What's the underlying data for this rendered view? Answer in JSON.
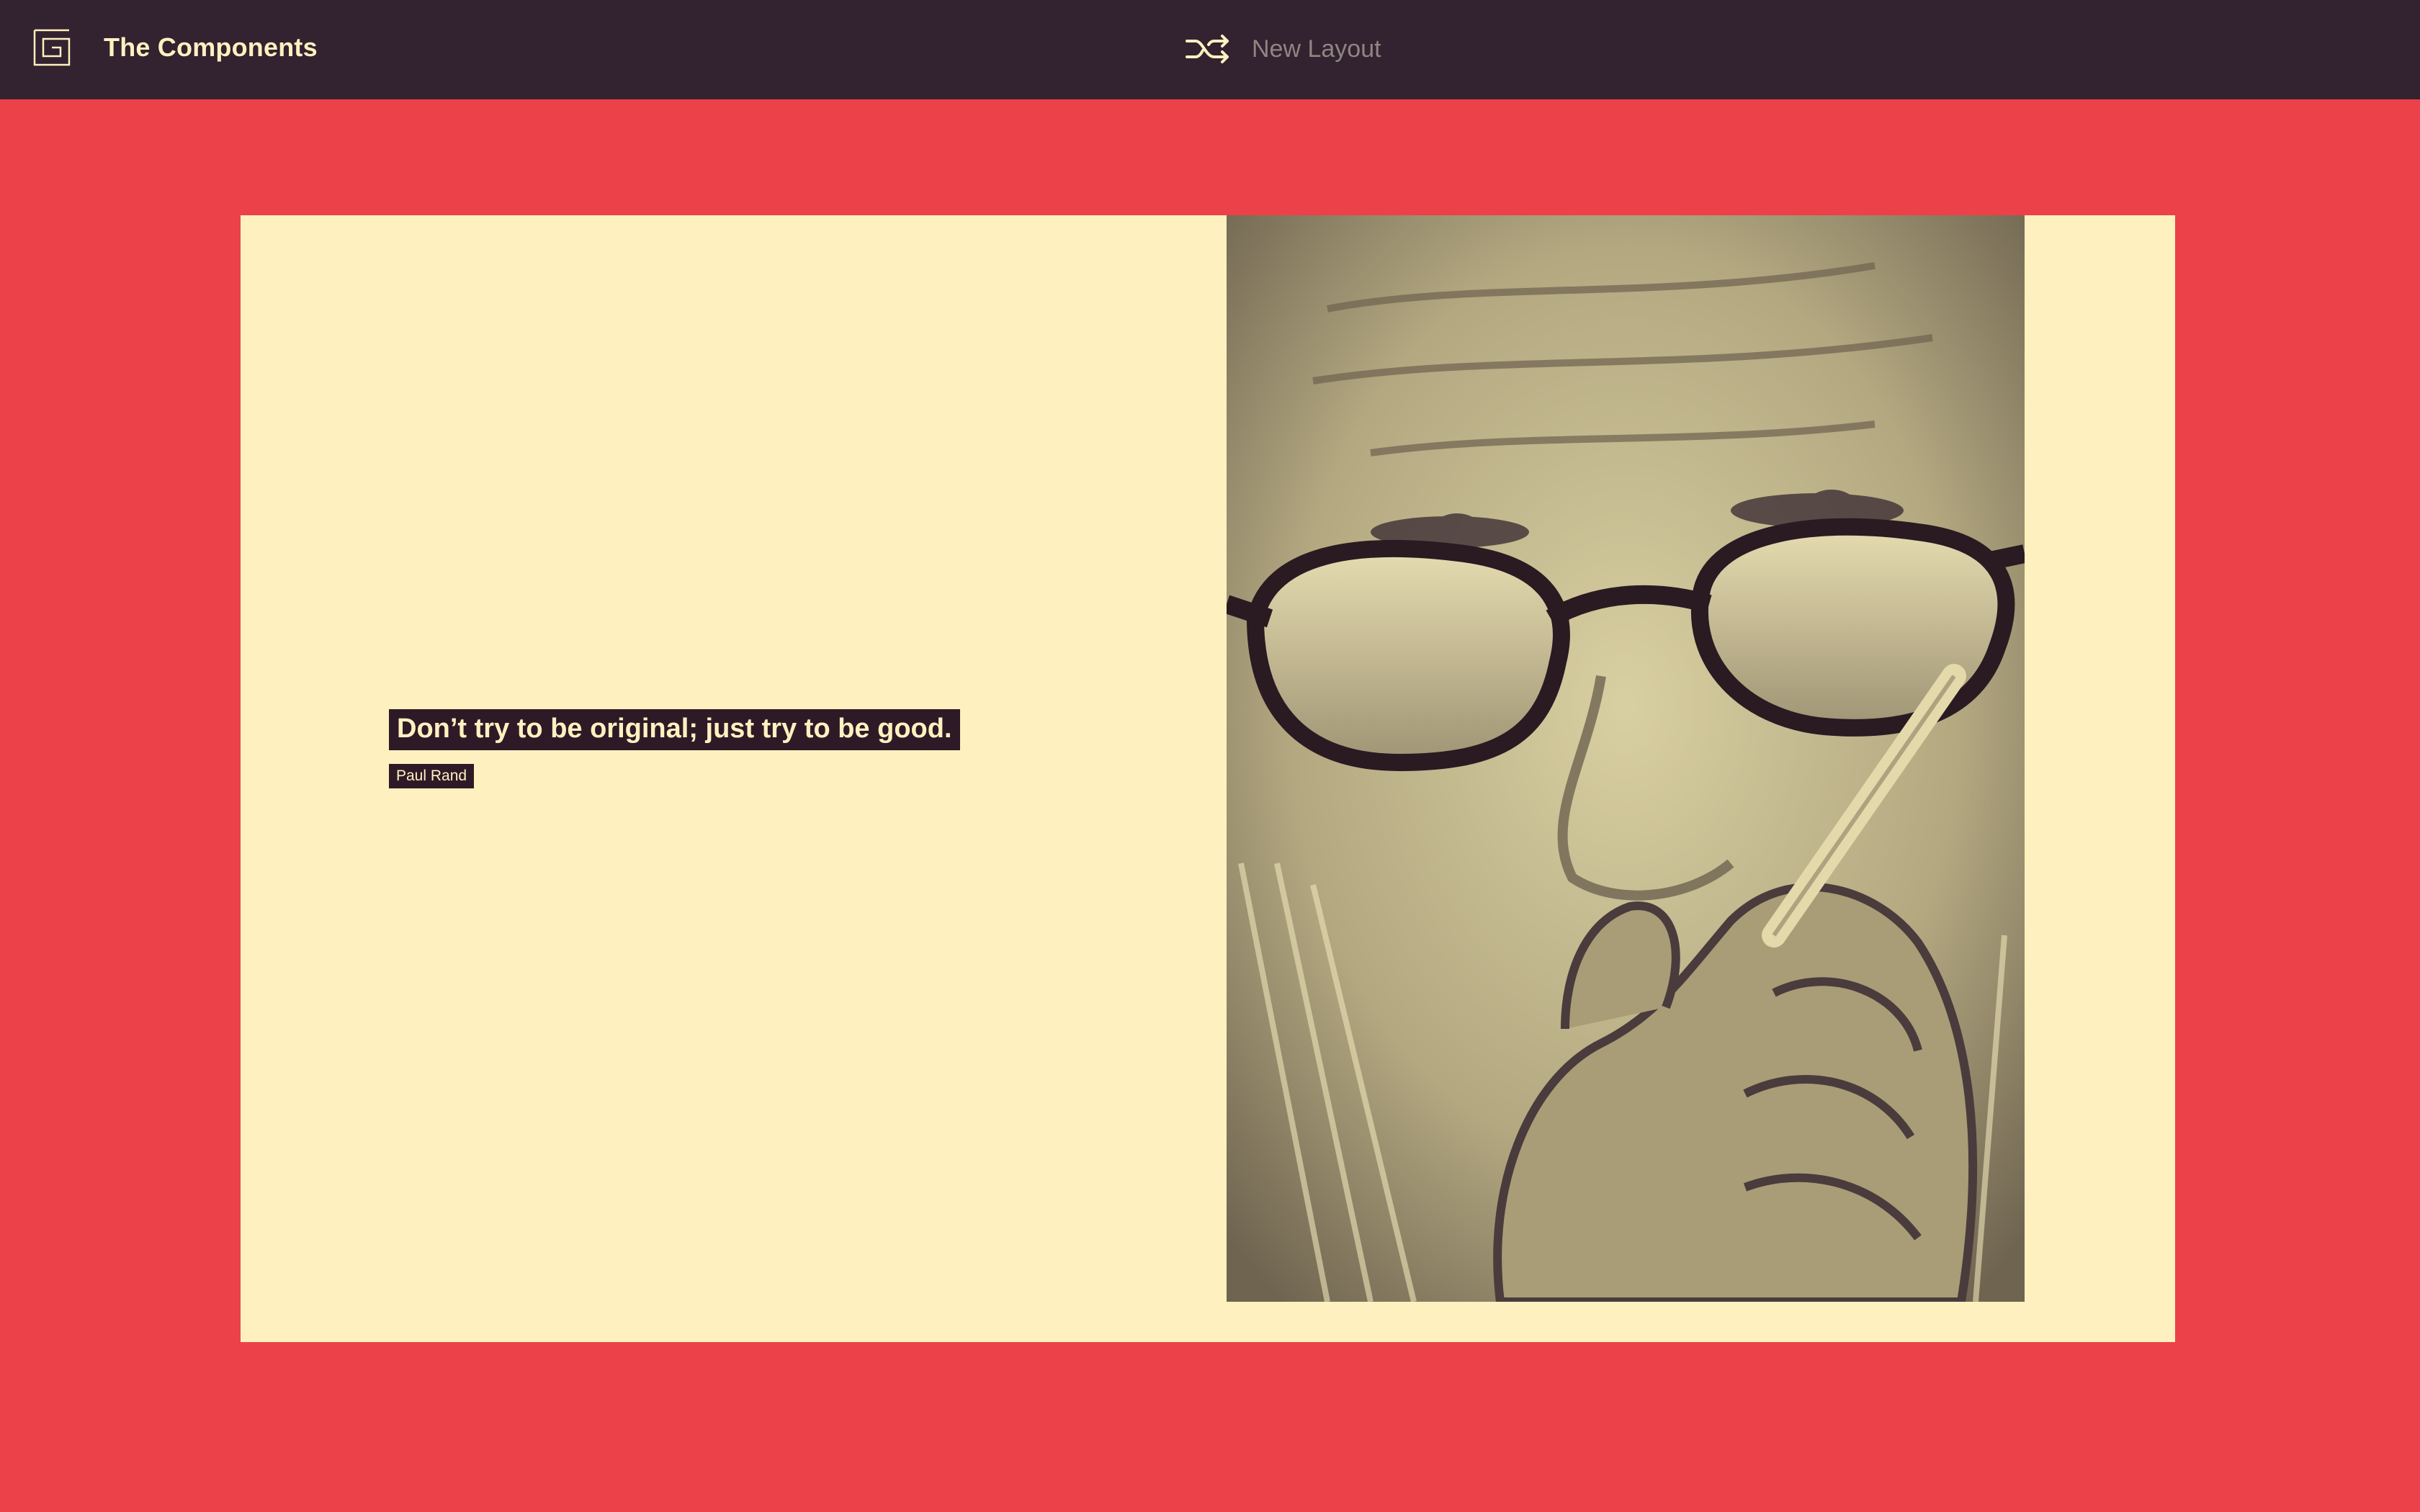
{
  "header": {
    "app_title": "The Components",
    "logo_icon": "spiral-logo-icon",
    "layout_button": {
      "label": "New Layout",
      "icon": "shuffle-icon"
    }
  },
  "content": {
    "quote": "Don’t try to be original; just try to be good.",
    "author": "Paul Rand",
    "photo_icon": "portrait-photo"
  },
  "colors": {
    "background": "#ec4149",
    "header": "#33222f",
    "card": "#fef1bf",
    "label_bg": "#2e1a27",
    "text_light": "#fff1c0",
    "muted": "#8f8584"
  }
}
